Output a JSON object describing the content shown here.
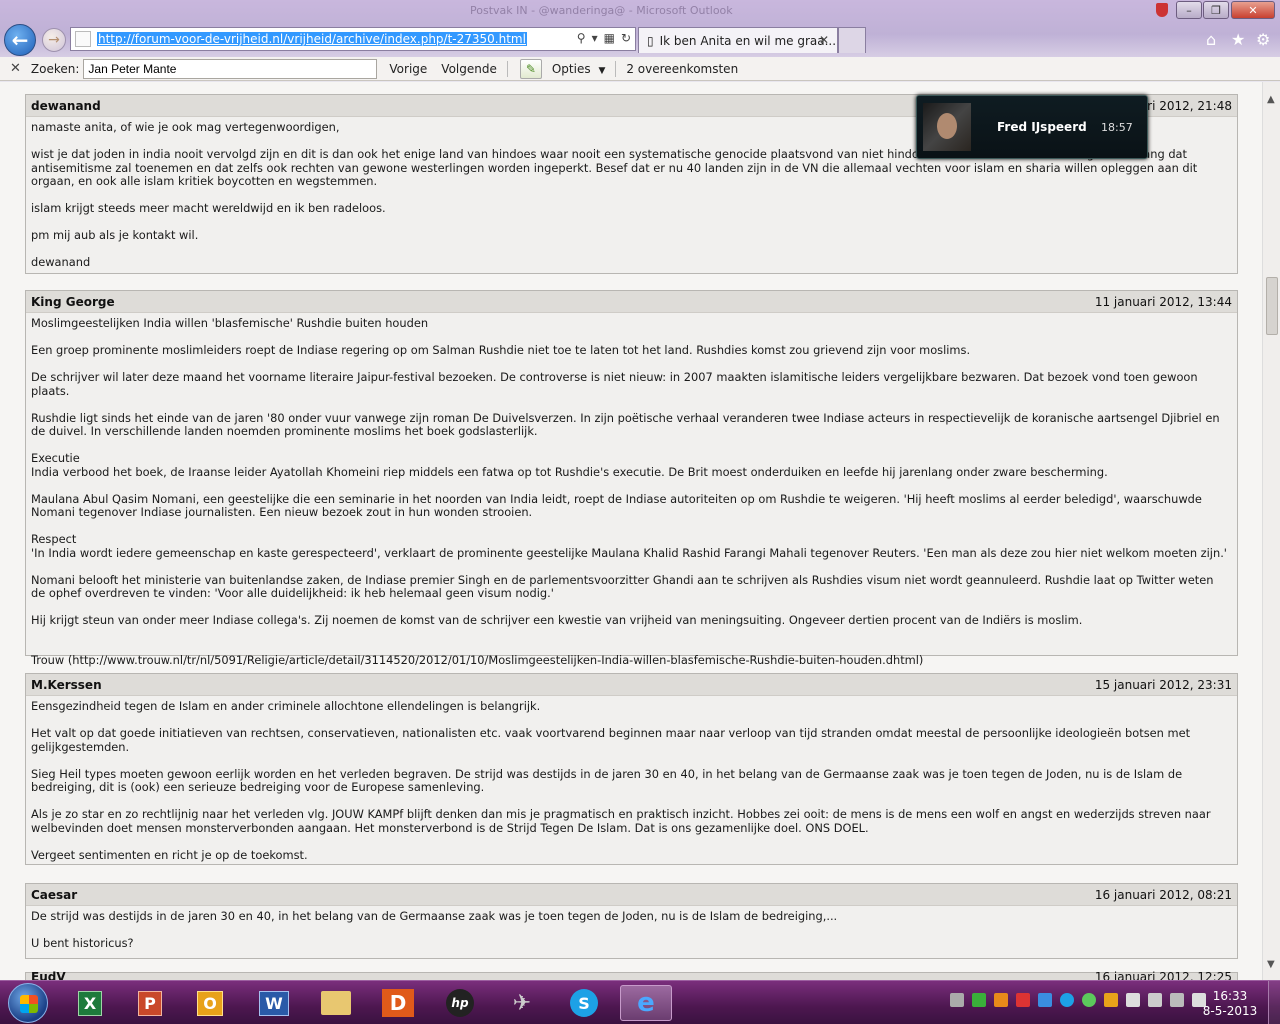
{
  "window": {
    "title": "Postvak IN - @wanderinga@ - Microsoft Outlook"
  },
  "browser": {
    "url": "http://forum-voor-de-vrijheid.nl/vrijheid/archive/index.php/t-27350.html",
    "tab_title": "Ik ben Anita en wil me graa...",
    "back_label": "←",
    "forward_label": "→"
  },
  "findbar": {
    "close_label": "✕",
    "label": "Zoeken:",
    "query": "Jan Peter Mante",
    "previous": "Vorige",
    "next": "Volgende",
    "options": "Opties",
    "options_arrow": "▼",
    "matches": "2 overeenkomsten"
  },
  "posts": [
    {
      "author": "dewanand",
      "date": "ari 2012, 21:48",
      "paragraphs": [
        "namaste anita, of wie je ook mag vertegenwoordigen,",
        "wist je dat joden in india nooit vervolgd zijn en dit is dan ook het enige land van hindoes waar nooit een systematische genocide plaatsvond van niet hindoes d                                        want door de islamisering ben ik bang dat antisemitisme zal toenemen en dat zelfs ook rechten van gewone westerlingen worden ingeperkt. Besef dat er nu 40 landen zijn in de VN die allemaal vechten voor islam en sharia willen opleggen aan dit orgaan, en ook alle islam kritiek boycotten en wegstemmen.",
        "islam krijgt steeds meer macht wereldwijd en ik ben radeloos.",
        "pm mij aub als je kontakt wil.",
        "dewanand"
      ]
    },
    {
      "author": "King George",
      "date": "11 januari 2012, 13:44",
      "paragraphs": [
        "Moslimgeestelijken India willen 'blasfemische' Rushdie buiten houden",
        "Een groep prominente moslimleiders roept de Indiase regering op om Salman Rushdie niet toe te laten tot het land. Rushdies komst zou grievend zijn voor moslims.",
        "De schrijver wil later deze maand het voorname literaire Jaipur-festival bezoeken. De controverse is niet nieuw: in 2007 maakten islamitische leiders vergelijkbare bezwaren. Dat bezoek vond toen gewoon plaats.",
        "Rushdie ligt sinds het einde van de jaren '80 onder vuur vanwege zijn roman De Duivelsverzen. In zijn poëtische verhaal veranderen twee Indiase acteurs in respectievelijk de koranische aartsengel Djibriel en de duivel. In verschillende landen noemden prominente moslims het boek godslasterlijk.",
        "Executie",
        "India verbood het boek, de Iraanse leider Ayatollah Khomeini riep middels een fatwa op tot Rushdie's executie. De Brit moest onderduiken en leefde hij jarenlang onder zware bescherming.",
        "Maulana Abul Qasim Nomani, een geestelijke die een seminarie in het noorden van India leidt, roept de Indiase autoriteiten op om Rushdie te weigeren. 'Hij heeft moslims al eerder beledigd', waarschuwde Nomani tegenover Indiase journalisten. Een nieuw bezoek zout in hun wonden strooien.",
        "Respect",
        "'In India wordt iedere gemeenschap en kaste gerespecteerd', verklaart de prominente geestelijke Maulana Khalid Rashid Farangi Mahali tegenover Reuters. 'Een man als deze zou hier niet welkom moeten zijn.'",
        "Nomani belooft het ministerie van buitenlandse zaken, de Indiase premier Singh en de parlementsvoorzitter Ghandi aan te schrijven als Rushdies visum niet wordt geannuleerd. Rushdie laat op Twitter weten de ophef overdreven te vinden: 'Voor alle duidelijkheid: ik heb helemaal geen visum nodig.'",
        "Hij krijgt steun van onder meer Indiase collega's. Zij noemen de komst van de schrijver een kwestie van vrijheid van meningsuiting. Ongeveer dertien procent van de Indiërs is moslim.",
        "Trouw (http://www.trouw.nl/tr/nl/5091/Religie/article/detail/3114520/2012/01/10/Moslimgeestelijken-India-willen-blasfemische-Rushdie-buiten-houden.dhtml)"
      ]
    },
    {
      "author": "M.Kerssen",
      "date": "15 januari 2012, 23:31",
      "paragraphs": [
        "Eensgezindheid tegen de Islam en ander criminele allochtone ellendelingen is belangrijk.",
        "Het valt op dat goede initiatieven van rechtsen, conservatieven, nationalisten etc. vaak voortvarend beginnen maar naar verloop van tijd stranden omdat meestal de persoonlijke ideologieën botsen met gelijkgestemden.",
        "Sieg Heil types moeten gewoon eerlijk worden en het verleden begraven. De strijd was destijds in de jaren 30 en 40, in het belang van de Germaanse zaak was je toen tegen de Joden, nu is de Islam de bedreiging, dit is (ook) een serieuze bedreiging voor de Europese samenleving.",
        "Als je zo star en zo rechtlijnig naar het verleden vlg. JOUW KAMPf blijft denken dan mis je pragmatisch en praktisch inzicht. Hobbes zei ooit: de mens is de mens een wolf en angst en wederzijds streven naar welbevinden doet mensen monsterverbonden aangaan. Het monsterverbond is de Strijd Tegen De Islam. Dat is ons gezamenlijke doel. ONS DOEL.",
        "Vergeet sentimenten en richt je op de toekomst."
      ]
    },
    {
      "author": "Caesar",
      "date": "16 januari 2012, 08:21",
      "paragraphs": [
        "De strijd was destijds in de jaren 30 en 40, in het belang van de Germaanse zaak was je toen tegen de Joden, nu is de Islam de bedreiging,...",
        "U bent historicus?"
      ]
    },
    {
      "author": "EudV",
      "date": "16 januari 2012, 12:25"
    }
  ],
  "notification": {
    "name": "Fred IJspeerd",
    "time": "18:57"
  },
  "taskbar": {
    "apps": [
      "excel-icon",
      "powerpoint-icon",
      "outlook-icon",
      "word-icon",
      "explorer-icon",
      "dashlane-icon",
      "hp-icon",
      "plane-icon",
      "skype-icon",
      "ie-icon"
    ],
    "time": "16:33",
    "date": "8-5-2013"
  },
  "colors": {
    "taskbar": "#4d1750",
    "selection": "#3399ff",
    "post_header": "#dedcd8"
  }
}
